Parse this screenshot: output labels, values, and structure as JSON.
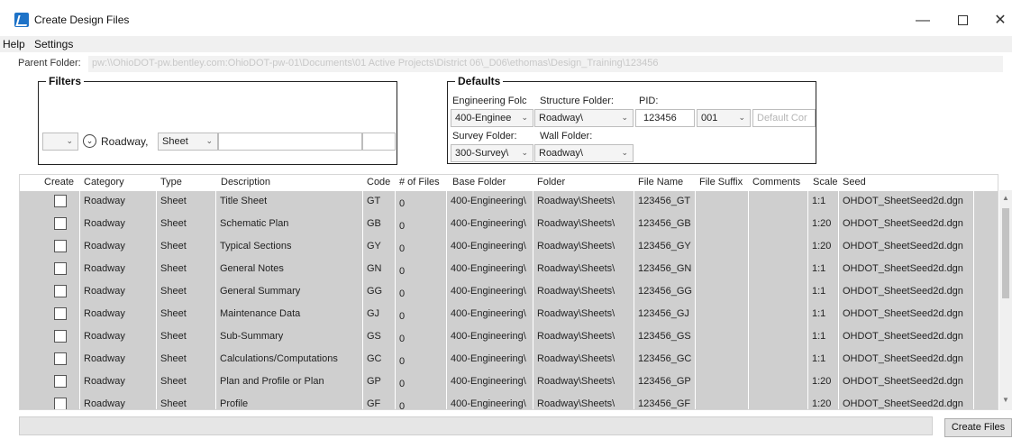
{
  "window": {
    "title": "Create Design Files",
    "minimize_glyph": "—",
    "close_glyph": "✕"
  },
  "menu": {
    "items": [
      "Help",
      "Settings"
    ]
  },
  "parent_folder": {
    "label": "Parent Folder:",
    "value": "pw:\\\\OhioDOT-pw.bentley.com:OhioDOT-pw-01\\Documents\\01 Active Projects\\District 06\\_D06\\ethomas\\Design_Training\\123456"
  },
  "filters": {
    "title": "Filters",
    "category_value": "Roadway,",
    "type_value": "Sheet",
    "expand_glyph": "⌄"
  },
  "defaults": {
    "title": "Defaults",
    "engineering_label": "Engineering Folc",
    "engineering_value": "400-Enginee",
    "structure_label": "Structure Folder:",
    "structure_value": "Roadway\\",
    "pid_label": "PID:",
    "pid_value": "123456",
    "pid_suffix_value": "001",
    "comment_placeholder": "Default Cor",
    "survey_label": "Survey Folder:",
    "survey_value": "300-Survey\\",
    "wall_label": "Wall Folder:",
    "wall_value": "Roadway\\"
  },
  "grid": {
    "headers": [
      "Create",
      "Category",
      "Type",
      "Description",
      "Code",
      "# of Files",
      "Base Folder",
      "Folder",
      "File Name",
      "File Suffix",
      "Comments",
      "Scale",
      "Seed"
    ],
    "rows": [
      {
        "category": "Roadway",
        "type": "Sheet",
        "description": "Title Sheet",
        "code": "GT",
        "files": "0",
        "base_folder": "400-Engineering\\",
        "folder": "Roadway\\Sheets\\",
        "file_name": "123456_GT",
        "file_suffix": "",
        "comments": "",
        "scale": "1:1",
        "seed": "OHDOT_SheetSeed2d.dgn"
      },
      {
        "category": "Roadway",
        "type": "Sheet",
        "description": "Schematic Plan",
        "code": "GB",
        "files": "0",
        "base_folder": "400-Engineering\\",
        "folder": "Roadway\\Sheets\\",
        "file_name": "123456_GB",
        "file_suffix": "",
        "comments": "",
        "scale": "1:20",
        "seed": "OHDOT_SheetSeed2d.dgn"
      },
      {
        "category": "Roadway",
        "type": "Sheet",
        "description": "Typical Sections",
        "code": "GY",
        "files": "0",
        "base_folder": "400-Engineering\\",
        "folder": "Roadway\\Sheets\\",
        "file_name": "123456_GY",
        "file_suffix": "",
        "comments": "",
        "scale": "1:20",
        "seed": "OHDOT_SheetSeed2d.dgn"
      },
      {
        "category": "Roadway",
        "type": "Sheet",
        "description": "General Notes",
        "code": "GN",
        "files": "0",
        "base_folder": "400-Engineering\\",
        "folder": "Roadway\\Sheets\\",
        "file_name": "123456_GN",
        "file_suffix": "",
        "comments": "",
        "scale": "1:1",
        "seed": "OHDOT_SheetSeed2d.dgn"
      },
      {
        "category": "Roadway",
        "type": "Sheet",
        "description": "General Summary",
        "code": "GG",
        "files": "0",
        "base_folder": "400-Engineering\\",
        "folder": "Roadway\\Sheets\\",
        "file_name": "123456_GG",
        "file_suffix": "",
        "comments": "",
        "scale": "1:1",
        "seed": "OHDOT_SheetSeed2d.dgn"
      },
      {
        "category": "Roadway",
        "type": "Sheet",
        "description": "Maintenance Data",
        "code": "GJ",
        "files": "0",
        "base_folder": "400-Engineering\\",
        "folder": "Roadway\\Sheets\\",
        "file_name": "123456_GJ",
        "file_suffix": "",
        "comments": "",
        "scale": "1:1",
        "seed": "OHDOT_SheetSeed2d.dgn"
      },
      {
        "category": "Roadway",
        "type": "Sheet",
        "description": "Sub-Summary",
        "code": "GS",
        "files": "0",
        "base_folder": "400-Engineering\\",
        "folder": "Roadway\\Sheets\\",
        "file_name": "123456_GS",
        "file_suffix": "",
        "comments": "",
        "scale": "1:1",
        "seed": "OHDOT_SheetSeed2d.dgn"
      },
      {
        "category": "Roadway",
        "type": "Sheet",
        "description": "Calculations/Computations",
        "code": "GC",
        "files": "0",
        "base_folder": "400-Engineering\\",
        "folder": "Roadway\\Sheets\\",
        "file_name": "123456_GC",
        "file_suffix": "",
        "comments": "",
        "scale": "1:1",
        "seed": "OHDOT_SheetSeed2d.dgn"
      },
      {
        "category": "Roadway",
        "type": "Sheet",
        "description": "Plan and Profile or Plan",
        "code": "GP",
        "files": "0",
        "base_folder": "400-Engineering\\",
        "folder": "Roadway\\Sheets\\",
        "file_name": "123456_GP",
        "file_suffix": "",
        "comments": "",
        "scale": "1:20",
        "seed": "OHDOT_SheetSeed2d.dgn"
      },
      {
        "category": "Roadway",
        "type": "Sheet",
        "description": "Profile",
        "code": "GF",
        "files": "0",
        "base_folder": "400-Engineering\\",
        "folder": "Roadway\\Sheets\\",
        "file_name": "123456_GF",
        "file_suffix": "",
        "comments": "",
        "scale": "1:20",
        "seed": "OHDOT_SheetSeed2d.dgn"
      }
    ]
  },
  "footer": {
    "create_button": "Create Files"
  }
}
